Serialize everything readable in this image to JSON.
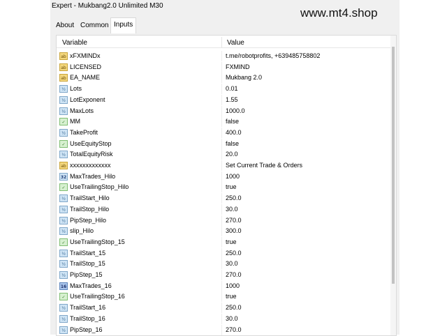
{
  "window": {
    "title": "Expert - Mukbang2.0 Unlimited M30"
  },
  "watermark": "www.mt4.shop",
  "tabs": [
    {
      "label": "About"
    },
    {
      "label": "Common"
    },
    {
      "label": "Inputs"
    }
  ],
  "table": {
    "headers": {
      "variable": "Variable",
      "value": "Value"
    },
    "rows": [
      {
        "type": "string",
        "icon": "ab",
        "variable": "xFXMINDx",
        "value": "t.me/robotprofits, +639485758802"
      },
      {
        "type": "string",
        "icon": "ab",
        "variable": "LICENSED",
        "value": "FXMIND"
      },
      {
        "type": "string",
        "icon": "ab",
        "variable": "EA_NAME",
        "value": "Mukbang 2.0"
      },
      {
        "type": "double",
        "icon": "½",
        "variable": "Lots",
        "value": "0.01"
      },
      {
        "type": "double",
        "icon": "½",
        "variable": "LotExponent",
        "value": "1.55"
      },
      {
        "type": "double",
        "icon": "½",
        "variable": "MaxLots",
        "value": "1000.0"
      },
      {
        "type": "bool",
        "icon": "✓",
        "variable": "MM",
        "value": "false"
      },
      {
        "type": "double",
        "icon": "½",
        "variable": "TakeProfit",
        "value": "400.0"
      },
      {
        "type": "bool",
        "icon": "✓",
        "variable": "UseEquityStop",
        "value": "false"
      },
      {
        "type": "double",
        "icon": "½",
        "variable": "TotalEquityRisk",
        "value": "20.0"
      },
      {
        "type": "string",
        "icon": "ab",
        "variable": "xxxxxxxxxxxxx",
        "value": "Set Current Trade & Orders"
      },
      {
        "type": "int",
        "icon": "32",
        "variable": "MaxTrades_Hilo",
        "value": "1000"
      },
      {
        "type": "bool",
        "icon": "✓",
        "variable": "UseTrailingStop_Hilo",
        "value": "true"
      },
      {
        "type": "double",
        "icon": "½",
        "variable": "TrailStart_Hilo",
        "value": "250.0"
      },
      {
        "type": "double",
        "icon": "½",
        "variable": "TrailStop_Hilo",
        "value": "30.0"
      },
      {
        "type": "double",
        "icon": "½",
        "variable": "PipStep_Hilo",
        "value": "270.0"
      },
      {
        "type": "double",
        "icon": "½",
        "variable": "slip_Hilo",
        "value": "300.0"
      },
      {
        "type": "bool",
        "icon": "✓",
        "variable": "UseTrailingStop_15",
        "value": "true"
      },
      {
        "type": "double",
        "icon": "½",
        "variable": "TrailStart_15",
        "value": "250.0"
      },
      {
        "type": "double",
        "icon": "½",
        "variable": "TrailStop_15",
        "value": "30.0"
      },
      {
        "type": "double",
        "icon": "½",
        "variable": "PipStep_15",
        "value": "270.0"
      },
      {
        "type": "int16",
        "icon": "16",
        "variable": "MaxTrades_16",
        "value": "1000"
      },
      {
        "type": "bool",
        "icon": "✓",
        "variable": "UseTrailingStop_16",
        "value": "true"
      },
      {
        "type": "double",
        "icon": "½",
        "variable": "TrailStart_16",
        "value": "250.0"
      },
      {
        "type": "double",
        "icon": "½",
        "variable": "TrailStop_16",
        "value": "30.0"
      },
      {
        "type": "double",
        "icon": "½",
        "variable": "PipStep_16",
        "value": "270.0"
      }
    ]
  }
}
